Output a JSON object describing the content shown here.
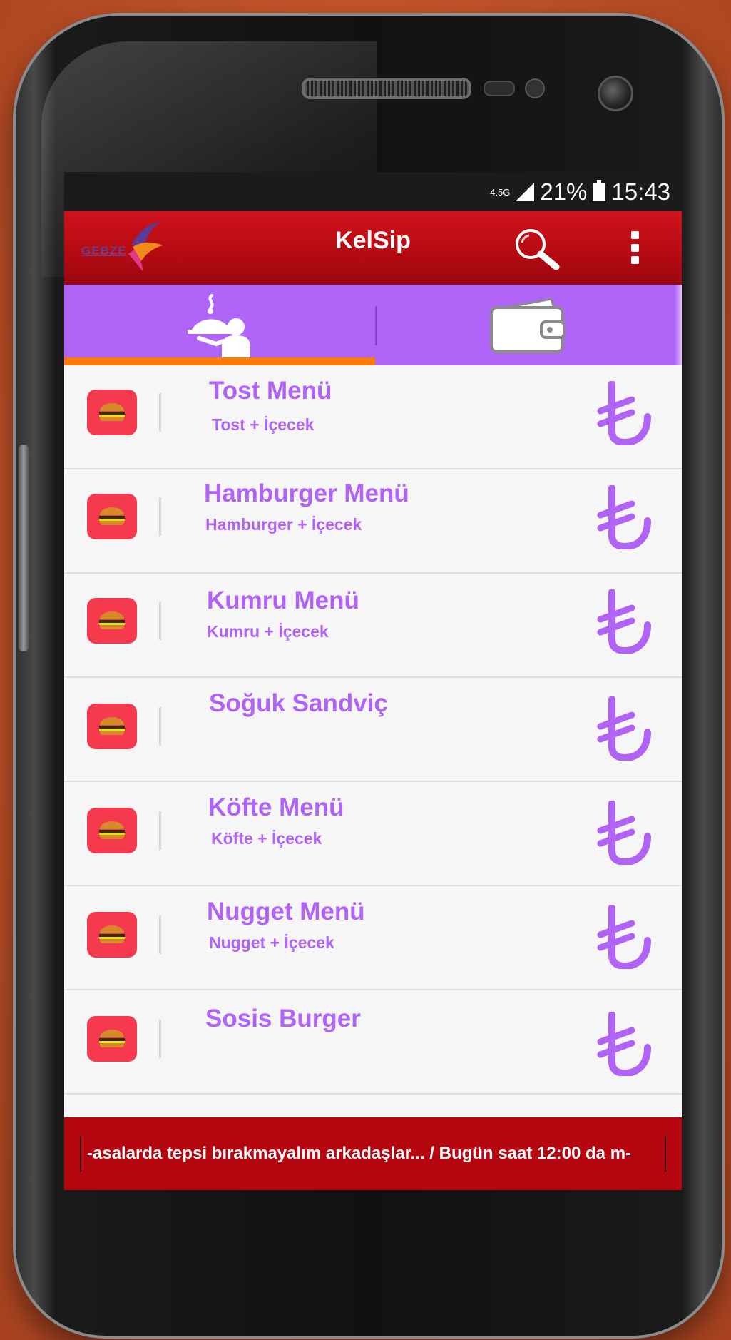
{
  "status_bar": {
    "network": "4.5G",
    "battery": "21%",
    "time": "15:43"
  },
  "app_bar": {
    "title": "KelSip",
    "logo_text": "GEBZE"
  },
  "colors": {
    "accent_purple": "#b065f8",
    "app_red": "#c20c16",
    "indicator_orange": "#ff7a00",
    "icon_red": "#f53a4d"
  },
  "tabs": [
    {
      "icon": "waiter-serving-icon",
      "selected": true
    },
    {
      "icon": "wallet-icon",
      "selected": false
    }
  ],
  "menu_items": [
    {
      "title": "Tost Menü",
      "subtitle": "Tost + İçecek",
      "icon": "burger-icon",
      "price_icon": "turkish-lira-icon"
    },
    {
      "title": "Hamburger Menü",
      "subtitle": "Hamburger + İçecek",
      "icon": "burger-icon",
      "price_icon": "turkish-lira-icon"
    },
    {
      "title": "Kumru Menü",
      "subtitle": "Kumru + İçecek",
      "icon": "burger-icon",
      "price_icon": "turkish-lira-icon"
    },
    {
      "title": "Soğuk Sandviç",
      "subtitle": "",
      "icon": "burger-icon",
      "price_icon": "turkish-lira-icon"
    },
    {
      "title": "Köfte Menü",
      "subtitle": "Köfte + İçecek",
      "icon": "burger-icon",
      "price_icon": "turkish-lira-icon"
    },
    {
      "title": "Nugget Menü",
      "subtitle": "Nugget + İçecek",
      "icon": "burger-icon",
      "price_icon": "turkish-lira-icon"
    },
    {
      "title": "Sosis Burger",
      "subtitle": "",
      "icon": "burger-icon",
      "price_icon": "turkish-lira-icon"
    }
  ],
  "ticker": {
    "text": "-asalarda tepsi bırakmayalım arkadaşlar... / Bugün saat 12:00 da m-"
  }
}
